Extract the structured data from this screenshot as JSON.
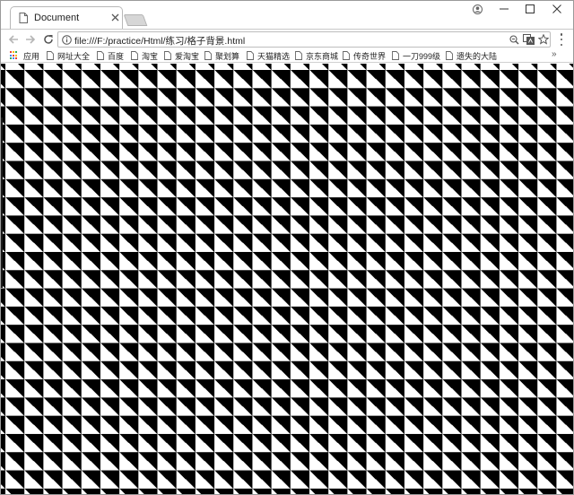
{
  "browser": {
    "tab": {
      "title": "Document"
    },
    "address_bar": {
      "url": "file:///F:/practice/Html/练习/格子背景.html"
    },
    "icons": {
      "tab": "page-icon",
      "back": "arrow-left-icon",
      "forward": "arrow-right-icon",
      "reload": "reload-icon",
      "info": "info-icon",
      "zoom": "zoom-icon",
      "translate": "translate-icon",
      "bookmark": "star-icon",
      "menu": "more-vertical-icon",
      "profile": "profile-icon",
      "minimize": "minimize-icon",
      "maximize": "maximize-icon",
      "close": "close-icon"
    },
    "bookmarks": [
      {
        "label": "应用",
        "icon": "apps-grid-icon"
      },
      {
        "label": "网址大全",
        "icon": "page-icon"
      },
      {
        "label": "百度",
        "icon": "page-icon"
      },
      {
        "label": "淘宝",
        "icon": "page-icon"
      },
      {
        "label": "爱淘宝",
        "icon": "page-icon"
      },
      {
        "label": "聚划算",
        "icon": "page-icon"
      },
      {
        "label": "天猫精选",
        "icon": "page-icon"
      },
      {
        "label": "京东商城",
        "icon": "page-icon"
      },
      {
        "label": "传奇世界",
        "icon": "page-icon"
      },
      {
        "label": "一刀999级",
        "icon": "page-icon"
      },
      {
        "label": "遗失的大陆",
        "icon": "page-icon"
      }
    ],
    "bookmarks_overflow": "»"
  },
  "page": {
    "pattern": {
      "fill_color": "#000000",
      "background_color": "#ffffff"
    }
  },
  "colors": {
    "apps_grid": [
      "#ea4335",
      "#fbbc05",
      "#34a853",
      "#4285f4",
      "#ea4335",
      "#fbbc05",
      "#34a853",
      "#4285f4",
      "#ea4335"
    ]
  }
}
